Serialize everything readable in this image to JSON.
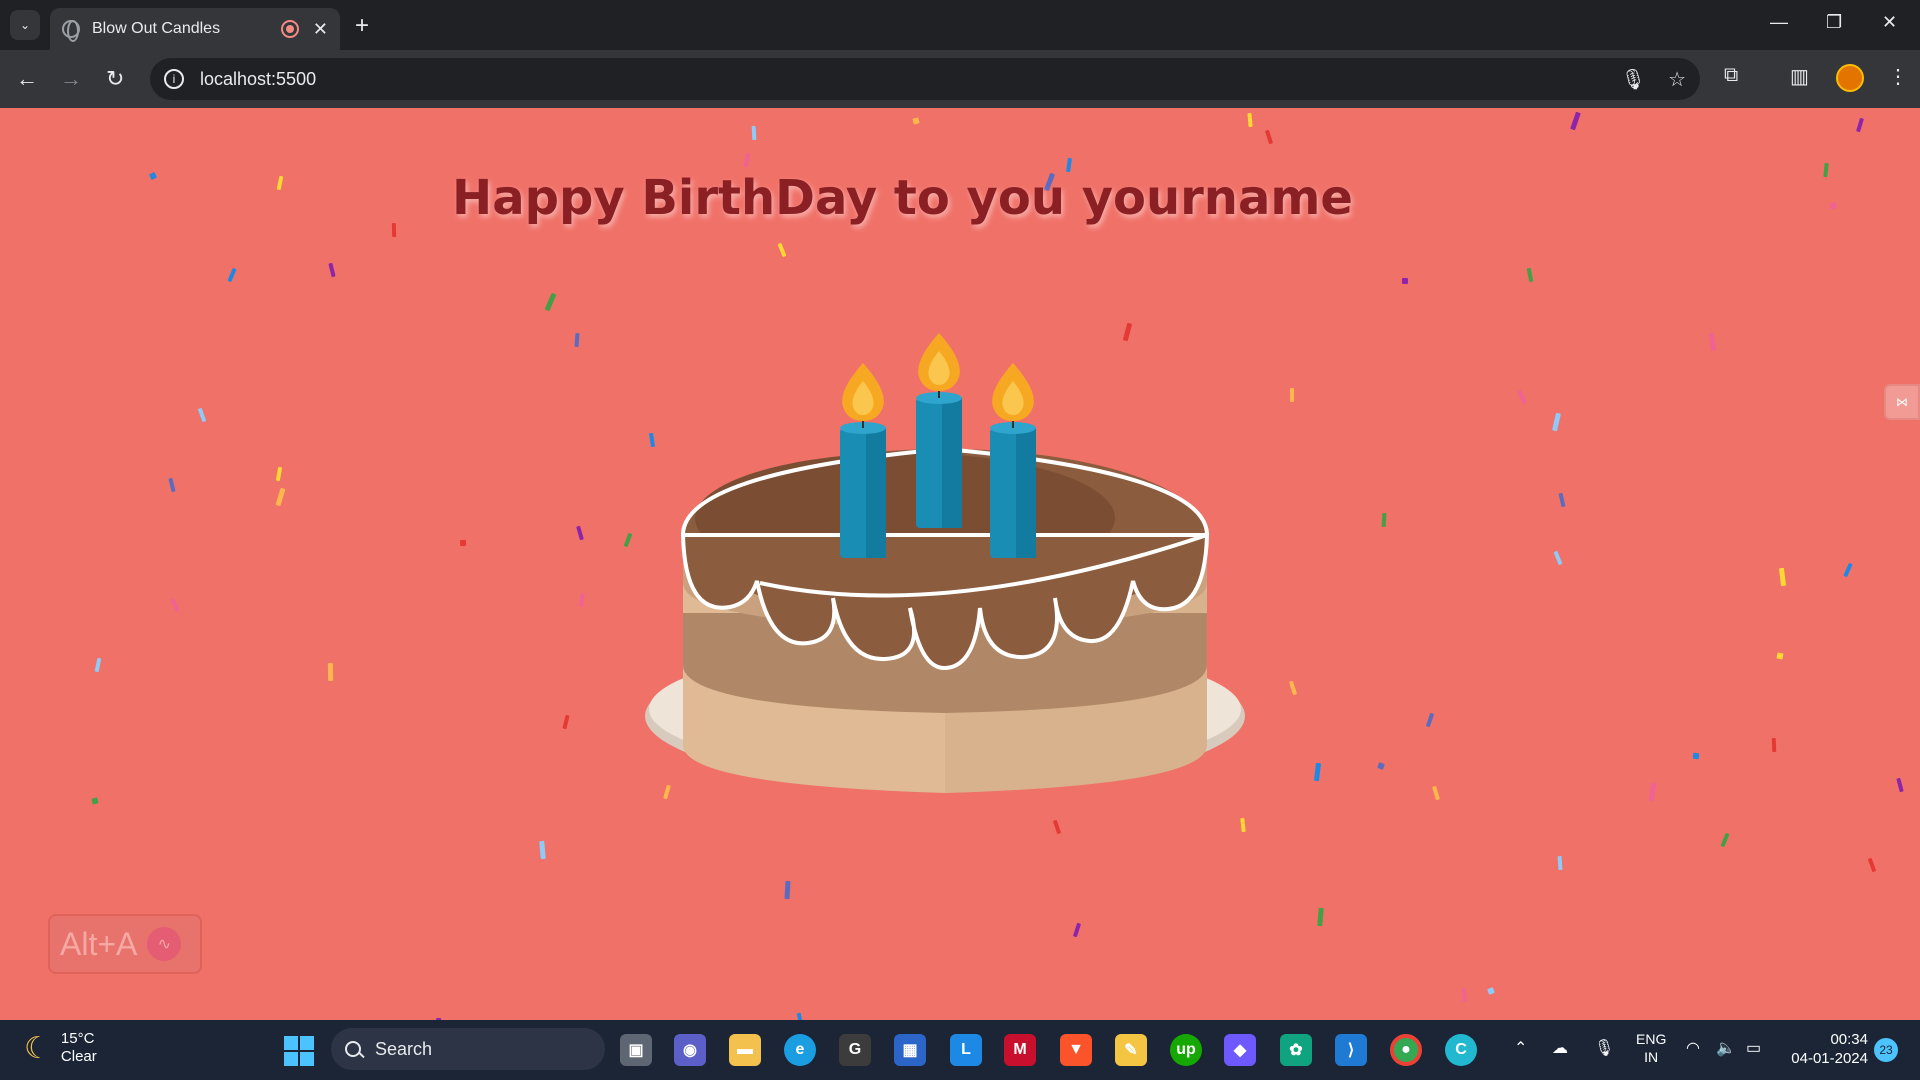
{
  "browser": {
    "tab_title": "Blow Out Candles",
    "url": "localhost:5500"
  },
  "page": {
    "heading": "Happy BirthDay to you yourname",
    "shortcut_label": "Alt+A",
    "colors": {
      "background": "#f07168",
      "heading": "#8a1f24",
      "cake_top": "#8b5a3c",
      "cake_body": "#dcb894",
      "candle": "#1a8db5",
      "flame": "#f7a823"
    }
  },
  "taskbar": {
    "weather_temp": "15°C",
    "weather_desc": "Clear",
    "search_placeholder": "Search",
    "language_top": "ENG",
    "language_bottom": "IN",
    "time": "00:34",
    "date": "04-01-2024",
    "notification_count": "23"
  }
}
